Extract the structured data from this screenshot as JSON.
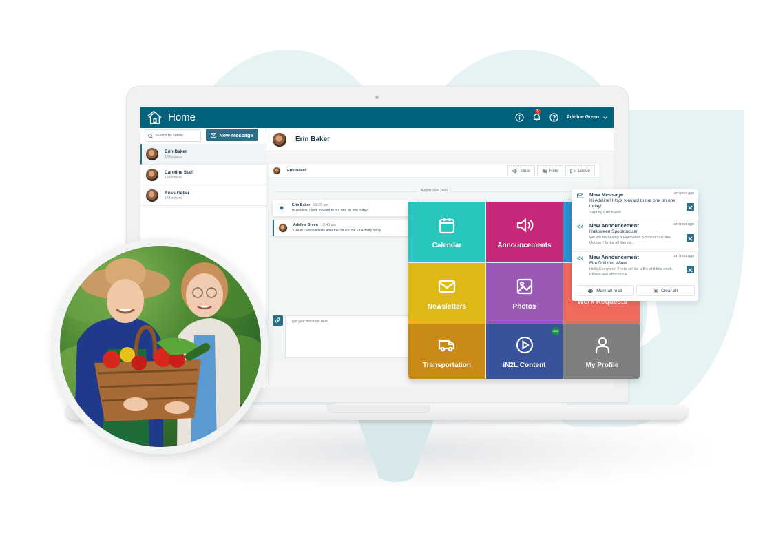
{
  "app": {
    "title": "Home",
    "user_name": "Adeline Green",
    "notification_count": "3"
  },
  "icons": {
    "home": "home-icon",
    "info": "info-icon",
    "bell": "bell-icon",
    "help": "help-icon",
    "chevron": "chevron-down-icon",
    "search": "search-icon",
    "mail": "mail-icon",
    "mute": "mute-icon",
    "hide": "eye-off-icon",
    "leave": "exit-icon",
    "attach": "paperclip-icon"
  },
  "sidebar": {
    "search_placeholder": "Search by Name",
    "new_message_label": "New Message",
    "conversations": [
      {
        "name": "Erin Baker",
        "members": "1 Members",
        "active": true
      },
      {
        "name": "Caroline Staff",
        "members": "1 Members",
        "active": false
      },
      {
        "name": "Ross Geller",
        "members": "1 Members",
        "active": false
      }
    ]
  },
  "chat": {
    "header_name": "Erin Baker",
    "panel_name": "Erin Baker",
    "actions": {
      "mute": "Mute",
      "hide": "Hide",
      "leave": "Leave"
    },
    "date": "August 29th 2023",
    "messages": [
      {
        "sender": "Erin Baker",
        "time": "10:39 am",
        "text": "Hi Adeline! I look forward to our one on one today!"
      },
      {
        "sender": "Adeline Green",
        "time": "10:40 am",
        "text": "Great! I am available after the Sit and Be Fit activity today."
      }
    ],
    "composer_placeholder": "Type your message here..."
  },
  "tiles": [
    {
      "label": "Calendar",
      "icon": "calendar-icon",
      "color": "#29c6bd"
    },
    {
      "label": "Announcements",
      "icon": "megaphone-icon",
      "color": "#c8287a"
    },
    {
      "label": "",
      "icon": "",
      "color": "#2e8fd2"
    },
    {
      "label": "Newsletters",
      "icon": "envelope-icon",
      "color": "#dfba16"
    },
    {
      "label": "Photos",
      "icon": "image-icon",
      "color": "#9b59b6"
    },
    {
      "label": "Work Requests",
      "icon": "",
      "color": "#f26a5e"
    },
    {
      "label": "Transportation",
      "icon": "van-icon",
      "color": "#c98a17"
    },
    {
      "label": "iN2L Content",
      "icon": "play-icon",
      "color": "#38529c",
      "badge": "NEW"
    },
    {
      "label": "My Profile",
      "icon": "user-icon",
      "color": "#7f7f7f"
    }
  ],
  "notifications": {
    "items": [
      {
        "type": "New Message",
        "icon": "mail-icon",
        "time": "an hour ago",
        "subject": "",
        "body": "Hi Adeline! I look forward to our one on one today!",
        "footer": "Sent by Erin Baker."
      },
      {
        "type": "New Announcement",
        "icon": "megaphone-icon",
        "time": "an hour ago",
        "subject": "Halloween Spooktacular",
        "body": "We will be having a Halloween Spooktacular this October! Invite all friends...",
        "footer": ""
      },
      {
        "type": "New Announcement",
        "icon": "megaphone-icon",
        "time": "an hour ago",
        "subject": "Fire Drill this Week",
        "body": "Hello Everyone! There will be a fire drill this week. Please see attached e...",
        "footer": ""
      }
    ],
    "mark_all_read": "Mark all read",
    "clear_all": "Clear all"
  },
  "colors": {
    "primary": "#02627c",
    "accent": "#2a6f86",
    "badge_red": "#e0402a",
    "new_badge_green": "#1e8a4c",
    "background_blob": "#e6f3f5"
  },
  "photo": {
    "description": "Two smiling senior women holding a wicker basket of vegetables in a garden"
  }
}
